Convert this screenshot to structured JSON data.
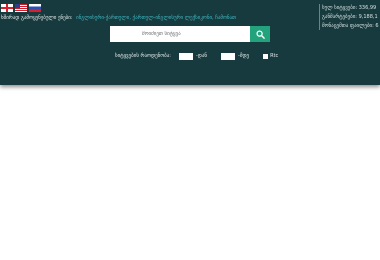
{
  "languages": {
    "georgian": {
      "icon": "flag-georgia-icon"
    },
    "english": {
      "icon": "flag-usa-icon"
    },
    "russian": {
      "icon": "flag-russia-icon"
    }
  },
  "popular": {
    "label": "ხშირად გამოყენებული ენები:",
    "link": "ინგლისური-ქართული, ქართულ-ინგლისური ლექსიკონი, ჩამონათ"
  },
  "stats": [
    "სულ სიტყვები: 336,99",
    "განმარტებები: 9,188,1",
    "მონაცემთა ფაილები: 6"
  ],
  "search": {
    "placeholder": "მოიძიეთ სიტყვა",
    "value": "",
    "button_icon": "search-icon",
    "button_color": "#22a37c"
  },
  "filters": {
    "length_label": "სიტყვების რაოდენობა:",
    "from_value": "",
    "from_label": "-დან",
    "to_value": "",
    "to_label": "-მდე",
    "checkbox_checked": false,
    "checkbox_label": "Rtc"
  },
  "colors": {
    "header_bg": "#173a3e",
    "link": "#3fb9c4",
    "accent": "#22a37c"
  }
}
